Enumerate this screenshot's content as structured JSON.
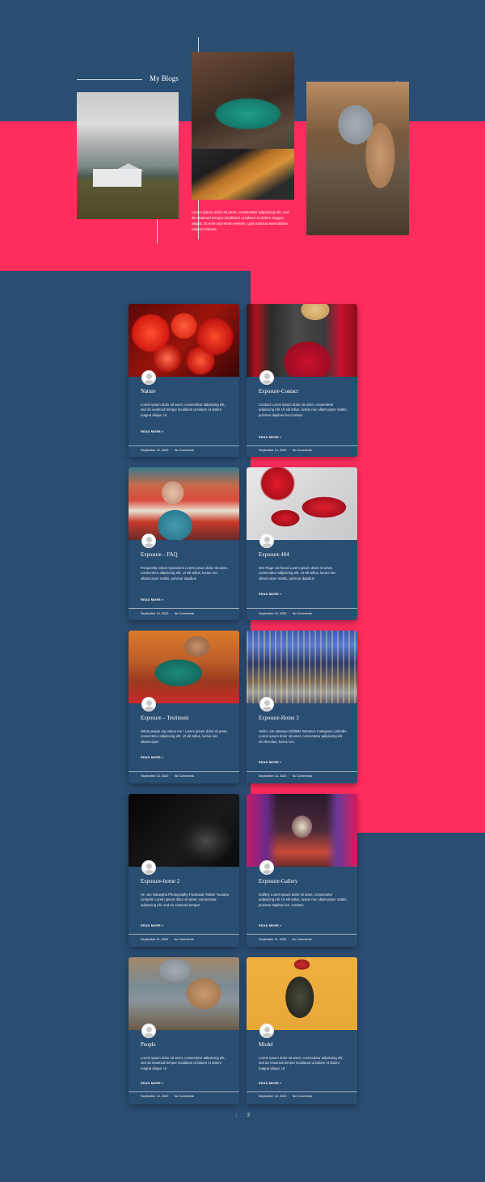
{
  "hero": {
    "title": "My Blogs",
    "text": "Lorem ipsum dolor sit amet, consectetur adipiscing elit, sed do eiusmod tempor incididunt ut labore et dolore magna aliqua. Ut enim ad minim veniam, quis nostrud exercitation ullamco laboris",
    "images": [
      "white houses on green field under cloudy sky",
      "feet in boots above a river gorge",
      "child in grey hat holding a teddy bear"
    ]
  },
  "colors": {
    "background": "#2a4d72",
    "accent": "#ff2d5e"
  },
  "posts": [
    {
      "title": "Nature",
      "excerpt": "Lorem ipsum dolor sit amet, consectetur adipiscing elit, sed do eiusmod tempor incididunt ut labore et dolore magna aliqua. Ut",
      "read_more": "READ MORE »",
      "date": "September 22, 2020",
      "comments": "No Comments",
      "image": "red paper lanterns"
    },
    {
      "title": "Exposure-Contact",
      "excerpt": "Contact Lorem ipsum dolor sit amet, consectetur adipiscing elit. Ut elit tellus, luctus nec ullamcorper mattis, pulvinar dapibus leo.Contact",
      "read_more": "READ MORE »",
      "date": "September 14, 2020",
      "comments": "No Comments",
      "image": "woman in red sweater and grey cardigan"
    },
    {
      "title": "Exposure – FAQ",
      "excerpt": "Frequently Asked Questions Lorem ipsum dolor sit amet, consectetur adipiscing elit. Ut elit tellus, luctus nec ullamcorper mattis, pulvinar dapibus",
      "read_more": "READ MORE »",
      "date": "September 14, 2020",
      "comments": "No Comments",
      "image": "woman in a retro diner"
    },
    {
      "title": "Exposure 404",
      "excerpt": "404 Page not found Lorem ipsum dolor sit amet, consectetur adipiscing elit. Ut elit tellus, luctus nec ullamcorper mattis, pulvinar dapibus",
      "read_more": "READ MORE »",
      "date": "September 14, 2020",
      "comments": "No Comments",
      "image": "red items on white background"
    },
    {
      "title": "Exposure – Testimoni",
      "excerpt": "What people say about me ! Lorem ipsum dolor sit amet, consectetur adipiscing elit. Ut elit tellus, luctus nec ullamcorper",
      "read_more": "READ MORE »",
      "date": "September 14, 2020",
      "comments": "No Comments",
      "image": "woman in orange room"
    },
    {
      "title": "Exposure-Home 3",
      "excerpt": "Hello I am natasya Dribbble Behance Instagram LinkedIn Lorem ipsum dolor sit amet, consectetur adipiscing elit. Ut elit tellus, luctus nec",
      "read_more": "READ MORE »",
      "date": "September 14, 2020",
      "comments": "No Comments",
      "image": "city skyline at dusk"
    },
    {
      "title": "Exposure-home 2",
      "excerpt": "Hi I am Natasyha Photography Facebook Twitter Youtube LinkedIn Lorem ipsum dolor sit amet, consectetur adipiscing elit, sed do eiusmod tempor",
      "read_more": "READ MORE »",
      "date": "September 11, 2020",
      "comments": "No Comments",
      "image": "bicycle in the dark"
    },
    {
      "title": "Exposure-Gallery",
      "excerpt": "Gallery Lorem ipsum dolor sit amet, consectetur adipiscing elit. Ut elit tellus, luctus nec ullamcorper mattis, pulvinar dapibus leo. Contact",
      "read_more": "READ MORE »",
      "date": "September 11, 2020",
      "comments": "No Comments",
      "image": "graffiti tunnel"
    },
    {
      "title": "People",
      "excerpt": "Lorem ipsum dolor sit amet, consectetur adipiscing elit, sed do eiusmod tempor incididunt ut labore et dolore magna aliqua. Ut",
      "read_more": "READ MORE »",
      "date": "September 10, 2020",
      "comments": "No Comments",
      "image": "child with teddy bear"
    },
    {
      "title": "Model",
      "excerpt": "Lorem ipsum dolor sit amet, consectetur adipiscing elit, sed do eiusmod tempor incididunt ut labore et dolore magna aliqua. Ut",
      "read_more": "READ MORE »",
      "date": "September 10, 2020",
      "comments": "No Comments",
      "image": "model in floral dress on yellow background"
    }
  ],
  "pagination": {
    "pages": [
      "1",
      "2"
    ],
    "current": "1"
  }
}
